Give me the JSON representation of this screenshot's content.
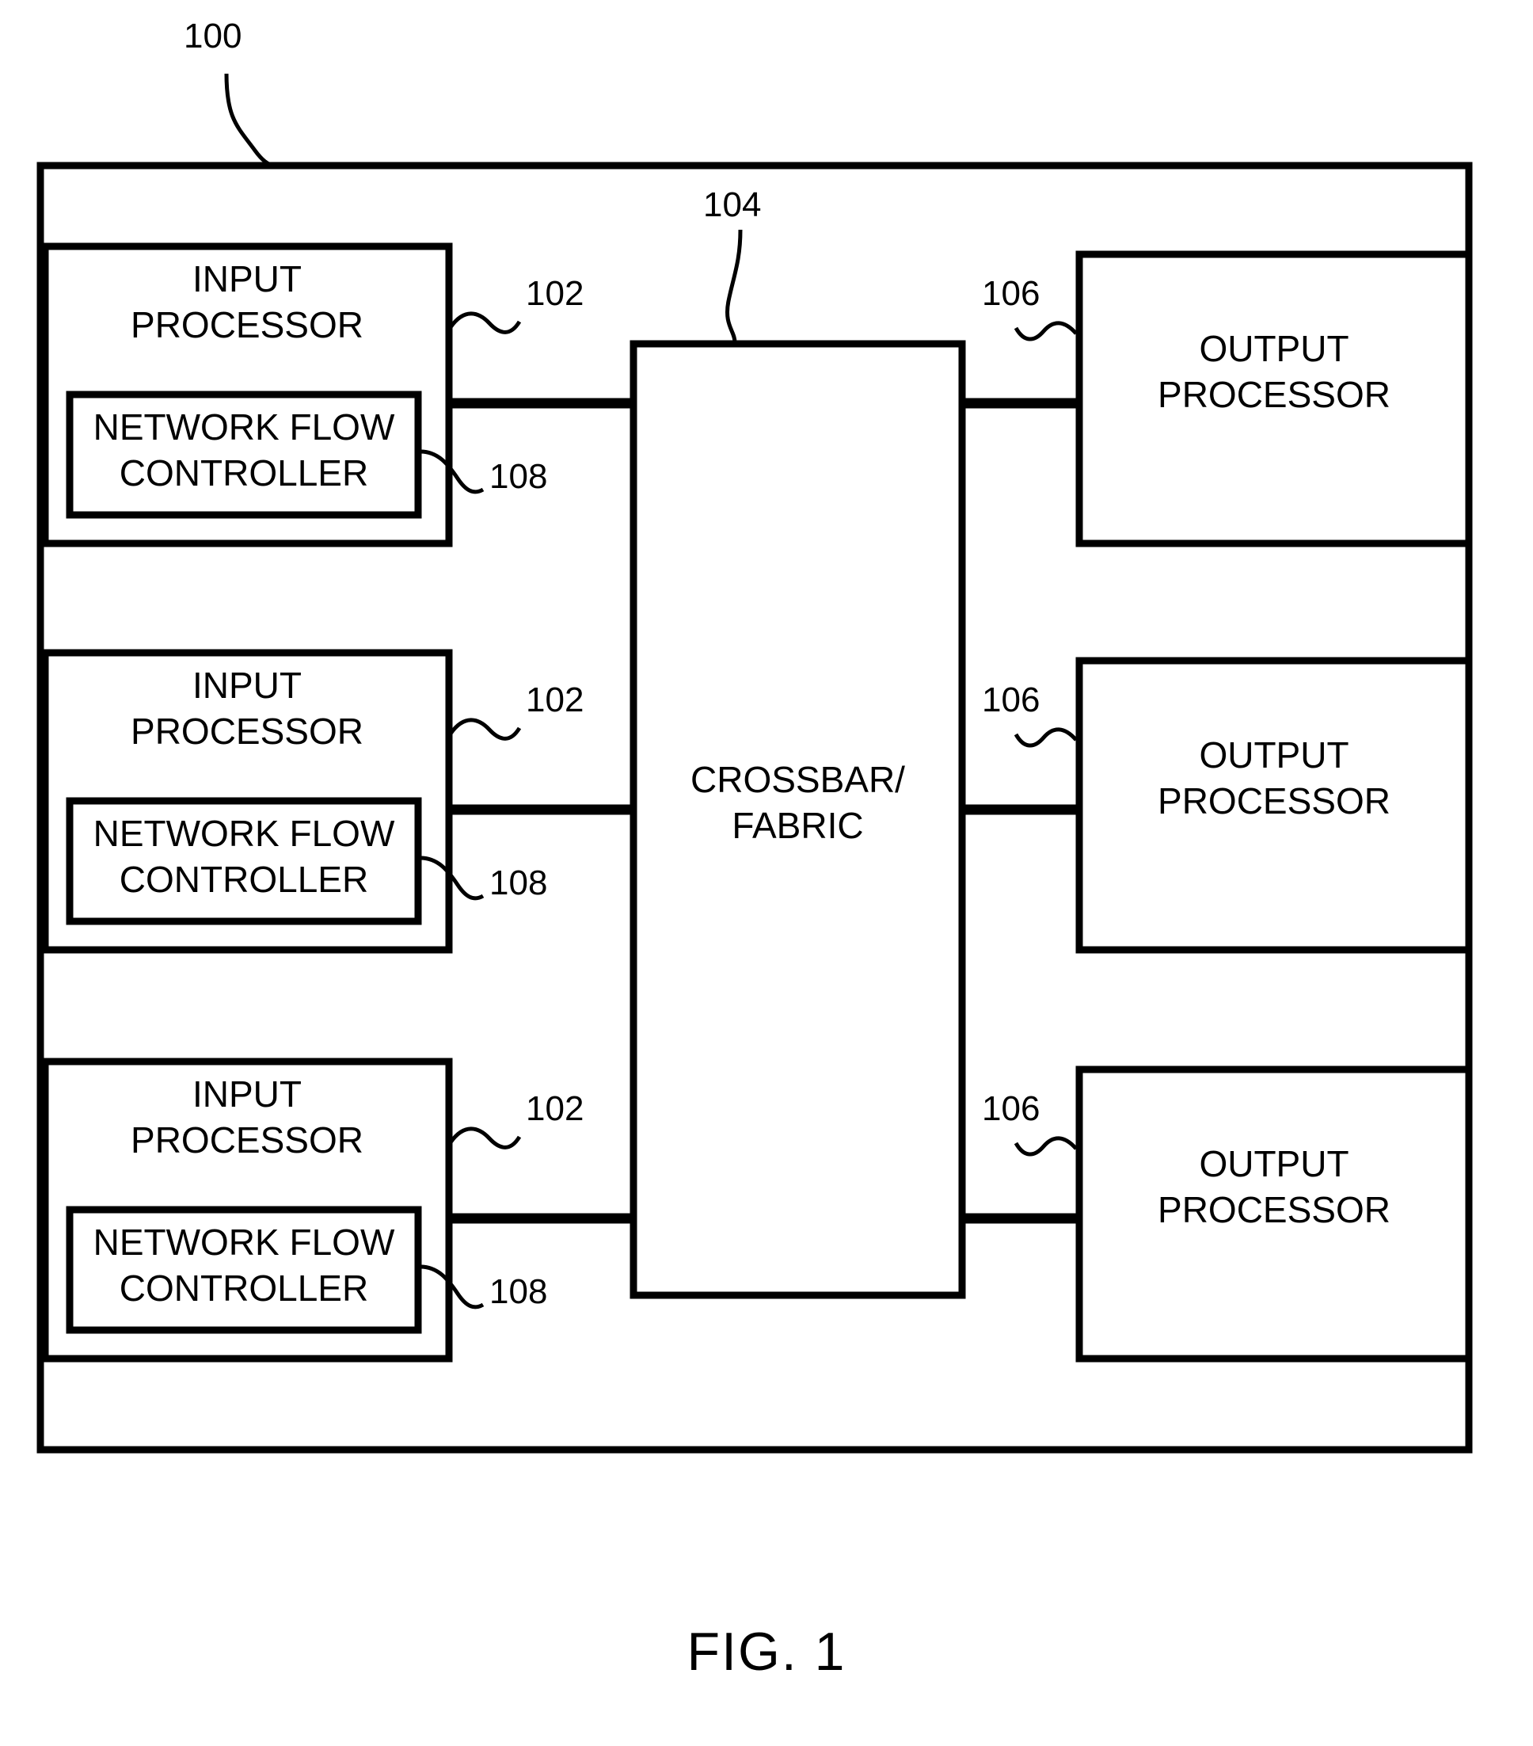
{
  "figure": {
    "caption": "FIG. 1",
    "system_ref": "100"
  },
  "blocks": {
    "input_processor_label_line1": "INPUT",
    "input_processor_label_line2": "PROCESSOR",
    "network_flow_controller_line1": "NETWORK FLOW",
    "network_flow_controller_line2": "CONTROLLER",
    "crossbar_label_line1": "CROSSBAR/",
    "crossbar_label_line2": "FABRIC",
    "output_processor_label_line1": "OUTPUT",
    "output_processor_label_line2": "PROCESSOR"
  },
  "refs": {
    "input_processor": "102",
    "crossbar": "104",
    "output_processor": "106",
    "network_flow_controller": "108"
  },
  "rows": [
    {
      "input_processor_ref": "102",
      "network_flow_controller_ref": "108",
      "output_processor_ref": "106"
    },
    {
      "input_processor_ref": "102",
      "network_flow_controller_ref": "108",
      "output_processor_ref": "106"
    },
    {
      "input_processor_ref": "102",
      "network_flow_controller_ref": "108",
      "output_processor_ref": "106"
    }
  ],
  "colors": {
    "stroke": "#000000",
    "background": "#ffffff"
  }
}
